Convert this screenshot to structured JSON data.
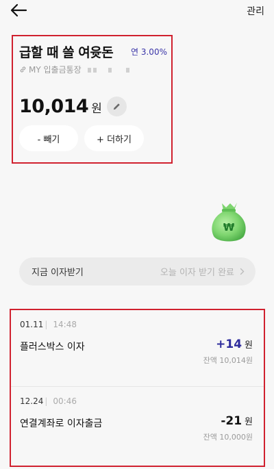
{
  "header": {
    "manage_label": "관리"
  },
  "account": {
    "name": "급할 때 쓸 여윳돈",
    "rate": "연 3.00%",
    "linked_label": "MY 입출금통장",
    "balance": "10,014",
    "currency": "원",
    "withdraw_label": "- 빼기",
    "add_label": "+ 더하기"
  },
  "interest": {
    "label": "지금 이자받기",
    "status": "오늘 이자 받기 완료"
  },
  "transactions": [
    {
      "date": "01.11",
      "time": "14:48",
      "title": "플러스박스 이자",
      "amount": "+14",
      "currency": "원",
      "balance": "잔액 10,014원"
    },
    {
      "date": "12.24",
      "time": "00:46",
      "title": "연결계좌로 이자출금",
      "amount": "-21",
      "currency": "원",
      "balance": "잔액 10,000원"
    }
  ],
  "icons": {
    "back": "arrow-left-icon",
    "link": "link-icon",
    "edit": "pencil-icon",
    "money_bag": "money-bag-icon",
    "chevron": "chevron-right-icon"
  },
  "colors": {
    "accent": "#3a35a8",
    "highlight_border": "#d0202e",
    "money_bag": "#7ed56f"
  }
}
